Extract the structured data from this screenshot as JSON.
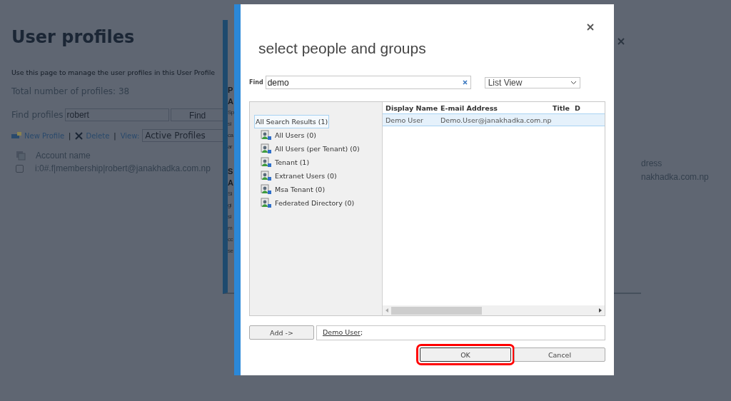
{
  "background_page": {
    "title": "User profiles",
    "description": "Use this page to manage the user profiles in this User Profile",
    "total": "Total number of profiles: 38",
    "find_label": "Find profiles",
    "find_value": "robert",
    "find_button": "Find",
    "toolbar": [
      {
        "kind": "new",
        "label": "New Profile"
      },
      {
        "kind": "separator",
        "label": "|"
      },
      {
        "kind": "delete",
        "label": "Delete"
      },
      {
        "kind": "separator",
        "label": "|"
      },
      {
        "kind": "view",
        "label": "View:"
      }
    ],
    "view_select": "Active Profiles",
    "columns": [
      "Account name"
    ],
    "rows": [
      {
        "checked": false,
        "account": "i:0#.f|membership|robert@janakhadka.com.np"
      }
    ],
    "right_fragments": [
      "dress",
      "nakhadka.com.np"
    ]
  },
  "middle_dialog": {
    "lines": [
      {
        "kind": "heading",
        "text": "P"
      },
      {
        "kind": "heading",
        "text": "A"
      },
      {
        "kind": "body",
        "text": "Sp"
      },
      {
        "kind": "body",
        "text": "si"
      },
      {
        "kind": "body",
        "text": "ca"
      },
      {
        "kind": "body",
        "text": "ar"
      },
      {
        "kind": "gap"
      },
      {
        "kind": "heading",
        "text": "S"
      },
      {
        "kind": "heading",
        "text": "A"
      },
      {
        "kind": "body",
        "text": "Si"
      },
      {
        "kind": "body",
        "text": "gi"
      },
      {
        "kind": "body",
        "text": "si"
      },
      {
        "kind": "body",
        "text": "m"
      },
      {
        "kind": "body",
        "text": "cc"
      },
      {
        "kind": "body",
        "text": "se"
      }
    ]
  },
  "dialog": {
    "title": "select people and groups",
    "find_label": "Find",
    "search_value": "demo",
    "view_select": "List View",
    "groups": [
      {
        "label": "All Search Results (1)",
        "selected": true,
        "children": [
          {
            "label": "All Users (0)",
            "selected": false
          },
          {
            "label": "All Users (per Tenant) (0)",
            "selected": false
          },
          {
            "label": "Tenant (1)",
            "selected": false
          },
          {
            "label": "Extranet Users (0)",
            "selected": false
          },
          {
            "label": "Msa Tenant (0)",
            "selected": false
          },
          {
            "label": "Federated Directory (0)",
            "selected": false
          }
        ]
      }
    ],
    "result_columns": [
      "Display Name",
      "E-mail Address",
      "Title",
      "D"
    ],
    "result_rows": [
      {
        "selected": true,
        "cells": [
          "Demo User",
          "Demo.User@janakhadka.com.np"
        ]
      }
    ],
    "add_button": "Add ->",
    "selected_people": [
      {
        "name": "Demo User"
      }
    ],
    "delimiter": ";",
    "buttons": [
      {
        "label": "OK",
        "highlighted": true
      },
      {
        "label": "Cancel",
        "highlighted": false
      }
    ]
  }
}
